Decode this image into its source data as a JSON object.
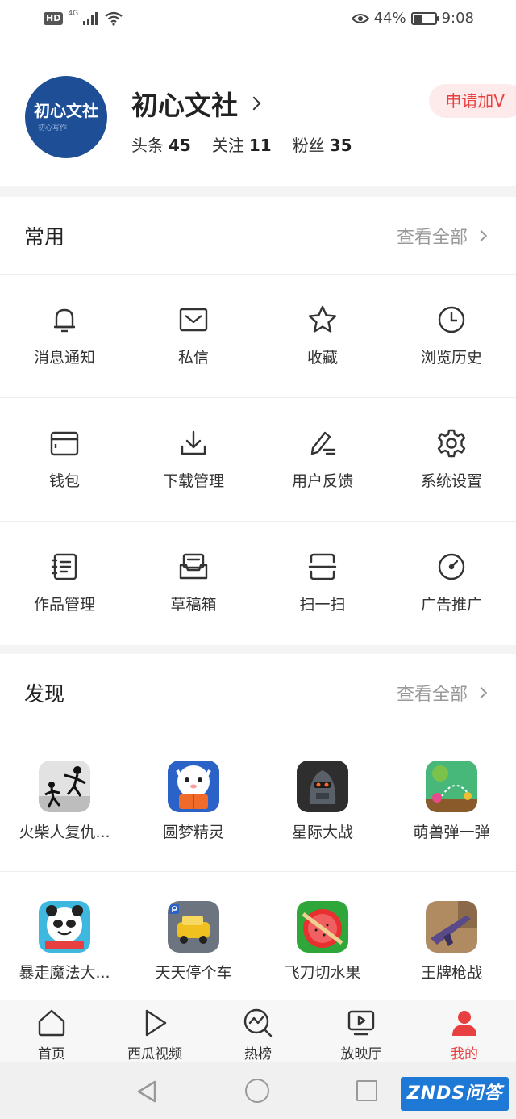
{
  "status_bar": {
    "hd": "HD",
    "network": "4G",
    "battery_percent": "44%",
    "battery_level": 0.44,
    "time": "9:08"
  },
  "profile": {
    "avatar_text": "初心文社",
    "avatar_subtext": "初心写作",
    "name": "初心文社",
    "stats": [
      {
        "label": "头条",
        "value": "45"
      },
      {
        "label": "关注",
        "value": "11"
      },
      {
        "label": "粉丝",
        "value": "35"
      }
    ],
    "apply_v_label": "申请加V"
  },
  "common": {
    "title": "常用",
    "see_all": "查看全部",
    "items": [
      {
        "label": "消息通知",
        "icon": "bell-icon"
      },
      {
        "label": "私信",
        "icon": "mail-icon"
      },
      {
        "label": "收藏",
        "icon": "star-icon"
      },
      {
        "label": "浏览历史",
        "icon": "clock-icon"
      },
      {
        "label": "钱包",
        "icon": "wallet-icon"
      },
      {
        "label": "下载管理",
        "icon": "download-icon"
      },
      {
        "label": "用户反馈",
        "icon": "pen-icon"
      },
      {
        "label": "系统设置",
        "icon": "gear-icon"
      },
      {
        "label": "作品管理",
        "icon": "notebook-icon"
      },
      {
        "label": "草稿箱",
        "icon": "draft-box-icon"
      },
      {
        "label": "扫一扫",
        "icon": "scan-icon"
      },
      {
        "label": "广告推广",
        "icon": "gauge-icon"
      }
    ]
  },
  "discover": {
    "title": "发现",
    "see_all": "查看全部",
    "games": [
      {
        "label": "火柴人复仇...",
        "icon": "stickman-game-icon",
        "color": "#dcdcdc"
      },
      {
        "label": "圆梦精灵",
        "icon": "sheep-reading-icon",
        "color": "#2a62c8"
      },
      {
        "label": "星际大战",
        "icon": "robot-soldier-icon",
        "color": "#3a3a3a"
      },
      {
        "label": "萌兽弹一弹",
        "icon": "bounce-beast-icon",
        "color": "#3aa86a"
      },
      {
        "label": "暴走魔法大...",
        "icon": "panda-face-icon",
        "color": "#3fb8e0"
      },
      {
        "label": "天天停个车",
        "icon": "parking-car-icon",
        "color": "#f0c020"
      },
      {
        "label": "飞刀切水果",
        "icon": "fruit-slice-icon",
        "color": "#2fa63a"
      },
      {
        "label": "王牌枪战",
        "icon": "rifle-icon",
        "color": "#b08a60"
      }
    ]
  },
  "tabbar": {
    "items": [
      {
        "label": "首页",
        "icon": "home-icon"
      },
      {
        "label": "西瓜视频",
        "icon": "play-icon"
      },
      {
        "label": "热榜",
        "icon": "trending-icon"
      },
      {
        "label": "放映厅",
        "icon": "screen-icon"
      },
      {
        "label": "我的",
        "icon": "user-icon"
      }
    ],
    "active_color": "#e84040"
  },
  "watermark": "ZNDS问答"
}
